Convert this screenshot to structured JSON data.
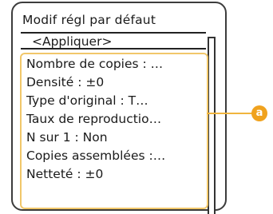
{
  "screen": {
    "title": "Modif régl par défaut",
    "apply_label": "<Appliquer>"
  },
  "settings_items": [
    "Nombre de copies : …",
    "Densité : ±0",
    "Type d'original : T…",
    "Taux de reproductio…",
    "N sur 1 : Non",
    "Copies assemblées :…",
    "Netteté : ±0"
  ],
  "callout": {
    "label": "a"
  },
  "colors": {
    "highlight": "#f1c76a",
    "callout": "#f0a21e"
  }
}
